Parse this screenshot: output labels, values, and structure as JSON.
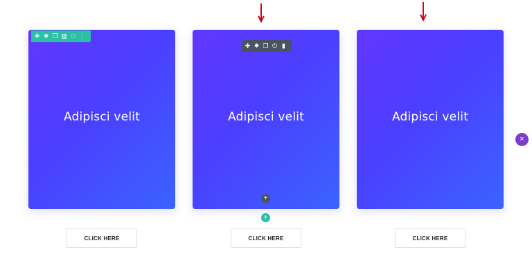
{
  "colors": {
    "gradient_start": "#6236ff",
    "gradient_end": "#3a63ff",
    "toolbar_green": "#2bbfa6",
    "toolbar_dark": "#4c5360",
    "close_purple": "#7d3bcf",
    "arrow_red": "#d0021b"
  },
  "cards": [
    {
      "title": "Adipisci velit",
      "button_label": "CLICK HERE"
    },
    {
      "title": "Adipisci velit",
      "button_label": "CLICK HERE"
    },
    {
      "title": "Adipisci velit",
      "button_label": "CLICK HERE"
    }
  ],
  "toolbars": {
    "module": {
      "icons": [
        "plus-icon",
        "gear-icon",
        "duplicate-icon",
        "columns-icon",
        "power-icon",
        "more-icon"
      ]
    },
    "row": {
      "icons": [
        "plus-icon",
        "gear-icon",
        "duplicate-icon",
        "power-icon",
        "trash-icon"
      ]
    }
  },
  "glyphs": {
    "plus": "✚",
    "gear": "✸",
    "duplicate": "❐",
    "columns": "▥",
    "power": "⏻",
    "more": "⋮",
    "trash": "▮",
    "add": "+",
    "close": "×"
  }
}
